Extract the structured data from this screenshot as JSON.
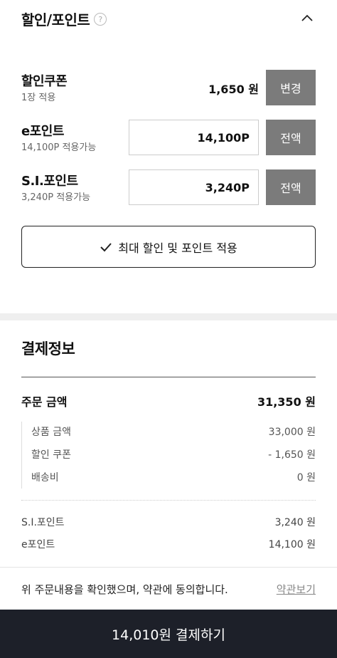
{
  "discount": {
    "title": "할인/포인트",
    "help": "?",
    "coupon": {
      "label": "할인쿠폰",
      "sub": "1장 적용",
      "value": "1,650 원",
      "button": "변경"
    },
    "epoint": {
      "label": "e포인트",
      "sub": "14,100P 적용가능",
      "value": "14,100P",
      "button": "전액"
    },
    "sipoint": {
      "label": "S.I.포인트",
      "sub": "3,240P 적용가능",
      "value": "3,240P",
      "button": "전액"
    },
    "max_button": "최대 할인 및 포인트 적용"
  },
  "payment": {
    "title": "결제정보",
    "order_amount": {
      "label": "주문 금액",
      "value": "31,350 원"
    },
    "details": [
      {
        "label": "상품 금액",
        "value": "33,000 원"
      },
      {
        "label": "할인 쿠폰",
        "value": "- 1,650 원"
      },
      {
        "label": "배송비",
        "value": "0 원"
      }
    ],
    "si_point": {
      "label": "S.I.포인트",
      "value": "3,240 원"
    },
    "e_point": {
      "label": "e포인트",
      "value": "14,100 원"
    }
  },
  "terms": {
    "text": "위 주문내용을 확인했으며, 약관에 동의합니다.",
    "link": "약관보기"
  },
  "pay_button": "14,010원 결제하기"
}
